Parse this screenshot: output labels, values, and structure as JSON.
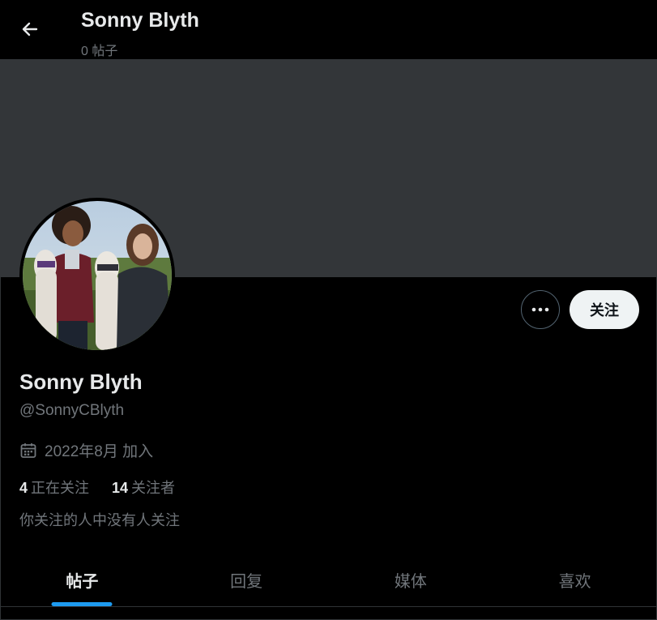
{
  "header": {
    "title": "Sonny Blyth",
    "post_count": "0 帖子"
  },
  "profile": {
    "name": "Sonny Blyth",
    "handle": "@SonnyCBlyth",
    "joined": "2022年8月 加入",
    "following_count": "4",
    "following_label": "正在关注",
    "followers_count": "14",
    "followers_label": "关注者",
    "mutual_note": "你关注的人中没有人关注"
  },
  "actions": {
    "follow_label": "关注",
    "more_icon": "more-horizontal-icon"
  },
  "tabs": [
    {
      "label": "帖子",
      "active": true
    },
    {
      "label": "回复",
      "active": false
    },
    {
      "label": "媒体",
      "active": false
    },
    {
      "label": "喜欢",
      "active": false
    }
  ],
  "colors": {
    "background": "#000000",
    "banner": "#333639",
    "accent": "#1d9bf0",
    "muted_text": "#71767b",
    "follow_button_bg": "#eff3f4"
  }
}
